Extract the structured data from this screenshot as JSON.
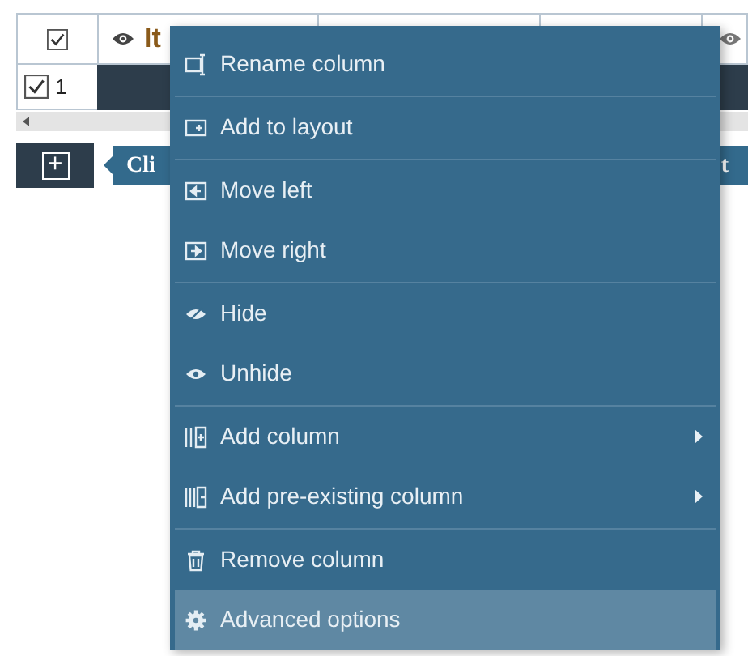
{
  "table": {
    "header": {
      "checked": true,
      "column_label": "It"
    },
    "row": {
      "checked": true,
      "number": "1"
    }
  },
  "add_button": {
    "label": "+"
  },
  "tooltip": {
    "text_start": "Cli",
    "text_end": "t"
  },
  "context_menu": {
    "items": [
      {
        "label": "Rename column",
        "submenu": false,
        "separator_after": true,
        "selected": false
      },
      {
        "label": "Add to layout",
        "submenu": false,
        "separator_after": true,
        "selected": false
      },
      {
        "label": "Move left",
        "submenu": false,
        "separator_after": false,
        "selected": false
      },
      {
        "label": "Move right",
        "submenu": false,
        "separator_after": true,
        "selected": false
      },
      {
        "label": "Hide",
        "submenu": false,
        "separator_after": false,
        "selected": false
      },
      {
        "label": "Unhide",
        "submenu": false,
        "separator_after": true,
        "selected": false
      },
      {
        "label": "Add column",
        "submenu": true,
        "separator_after": false,
        "selected": false
      },
      {
        "label": "Add pre-existing column",
        "submenu": true,
        "separator_after": true,
        "selected": false
      },
      {
        "label": "Remove column",
        "submenu": false,
        "separator_after": false,
        "selected": false
      },
      {
        "label": "Advanced options",
        "submenu": false,
        "separator_after": false,
        "selected": true
      }
    ]
  }
}
